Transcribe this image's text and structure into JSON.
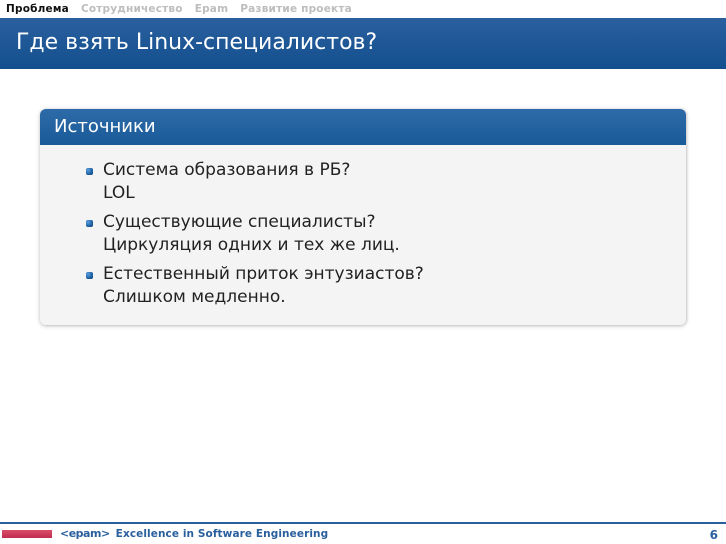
{
  "nav": {
    "items": [
      {
        "label": "Проблема",
        "active": true
      },
      {
        "label": "Сотрудничество",
        "active": false
      },
      {
        "label": "Epam",
        "active": false
      },
      {
        "label": "Развитие проекта",
        "active": false
      }
    ]
  },
  "title": "Где взять Linux-специалистов?",
  "block": {
    "title": "Источники",
    "items": [
      {
        "main": "Система образования в РБ?",
        "sub": "LOL"
      },
      {
        "main": "Существующие специалисты?",
        "sub": "Циркуляция одних и тех же лиц."
      },
      {
        "main": "Естественный приток энтузиастов?",
        "sub": "Слишком медленно."
      }
    ]
  },
  "footer": {
    "logo": "<epam>",
    "tagline": "Excellence in Software Engineering",
    "page": "6"
  }
}
